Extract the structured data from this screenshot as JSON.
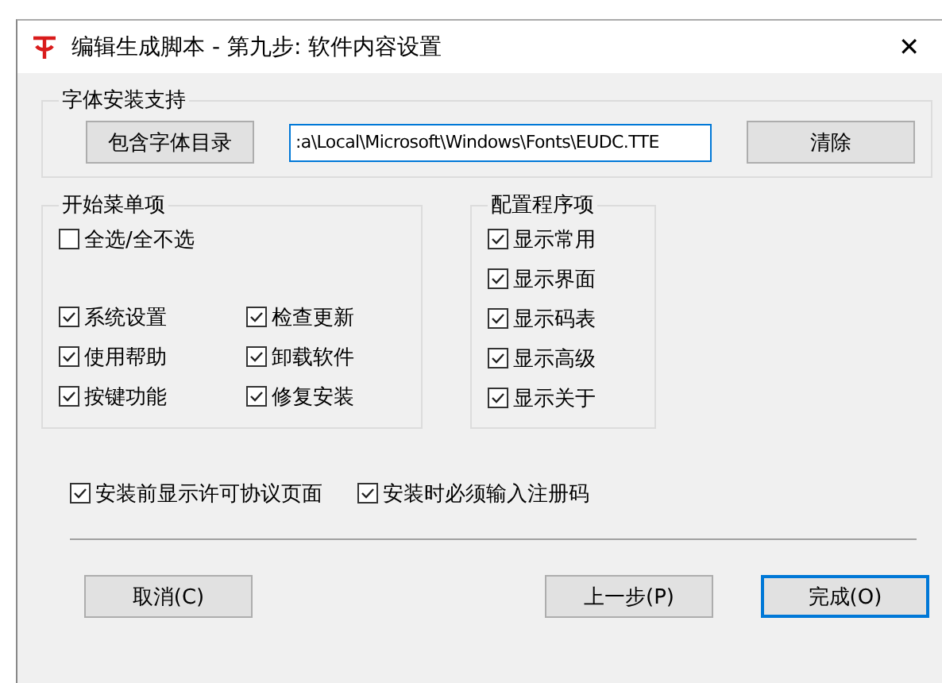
{
  "window": {
    "title": "编辑生成脚本 - 第九步: 软件内容设置",
    "close": "✕"
  },
  "font_group": {
    "title": "字体安装支持",
    "add_button": "包含字体目录",
    "path_value": ":a\\Local\\Microsoft\\Windows\\Fonts\\EUDC.TTE",
    "clear_button": "清除"
  },
  "start_menu": {
    "title": "开始菜单项",
    "select_all": {
      "label": "全选/全不选",
      "checked": false
    },
    "items": [
      {
        "label": "系统设置",
        "checked": true
      },
      {
        "label": "检查更新",
        "checked": true
      },
      {
        "label": "使用帮助",
        "checked": true
      },
      {
        "label": "卸载软件",
        "checked": true
      },
      {
        "label": "按键功能",
        "checked": true
      },
      {
        "label": "修复安装",
        "checked": true
      }
    ]
  },
  "config": {
    "title": "配置程序项",
    "items": [
      {
        "label": "显示常用",
        "checked": true
      },
      {
        "label": "显示界面",
        "checked": true
      },
      {
        "label": "显示码表",
        "checked": true
      },
      {
        "label": "显示高级",
        "checked": true
      },
      {
        "label": "显示关于",
        "checked": true
      }
    ]
  },
  "options": [
    {
      "label": "安装前显示许可协议页面",
      "checked": true
    },
    {
      "label": "安装时必须输入注册码",
      "checked": true
    }
  ],
  "buttons": [
    {
      "label": "取消(C)",
      "default": false
    },
    {
      "label": "上一步(P)",
      "default": false
    },
    {
      "label": "完成(O)",
      "default": true
    }
  ]
}
